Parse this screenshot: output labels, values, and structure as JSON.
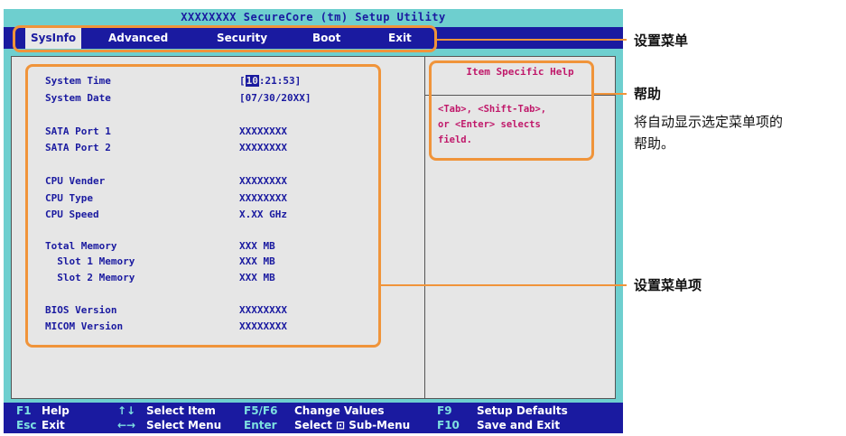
{
  "bios": {
    "title": "XXXXXXXX SecureCore (tm) Setup Utility",
    "menu": [
      "SysInfo",
      "Advanced",
      "Security",
      "Boot",
      "Exit"
    ],
    "selected_menu": "SysInfo",
    "items": [
      {
        "label": "System Time",
        "value_prefix": "[",
        "value_cursor": "10",
        "value_rest": ":21:53]"
      },
      {
        "label": "System Date",
        "value": "[07/30/20XX]"
      },
      {
        "label": "SATA Port 1",
        "value": "XXXXXXXX"
      },
      {
        "label": "SATA Port 2",
        "value": "XXXXXXXX"
      },
      {
        "label": "CPU Vender",
        "value": "XXXXXXXX"
      },
      {
        "label": "CPU Type",
        "value": "XXXXXXXX"
      },
      {
        "label": "CPU Speed",
        "value": "X.XX GHz"
      },
      {
        "label": "Total Memory",
        "value": "XXX MB"
      },
      {
        "label": "  Slot 1 Memory",
        "value": "XXX MB"
      },
      {
        "label": "  Slot 2 Memory",
        "value": "XXX MB"
      },
      {
        "label": "BIOS Version",
        "value": "XXXXXXXX"
      },
      {
        "label": "MICOM Version",
        "value": "XXXXXXXX"
      }
    ],
    "help": {
      "title": "Item Specific Help",
      "lines": [
        "<Tab>, <Shift-Tab>,",
        "or <Enter> selects",
        "field."
      ]
    },
    "footer": {
      "f1": "F1",
      "f1_desc": "Help",
      "arrows_ud": "↑↓",
      "select_item": "Select Item",
      "f5f6": "F5/F6",
      "change_values": "Change Values",
      "f9": "F9",
      "setup_defaults": "Setup Defaults",
      "esc": "Esc",
      "exit": "Exit",
      "arrows_lr": "←→",
      "select_menu": "Select Menu",
      "enter": "Enter",
      "select_submenu": "Select ⊡ Sub-Menu",
      "f10": "F10",
      "save_exit": "Save and Exit"
    }
  },
  "callouts": {
    "menu": "设置菜单",
    "help_title": "帮助",
    "help_desc_1": "将自动显示选定菜单项的",
    "help_desc_2": "帮助。",
    "items": "设置菜单项"
  },
  "colors": {
    "bios_bg": "#6ecfcf",
    "menubar": "#1a1aa0",
    "content_bg": "#e6e6e6",
    "help_text": "#c0186a",
    "callout": "#f0943a"
  }
}
